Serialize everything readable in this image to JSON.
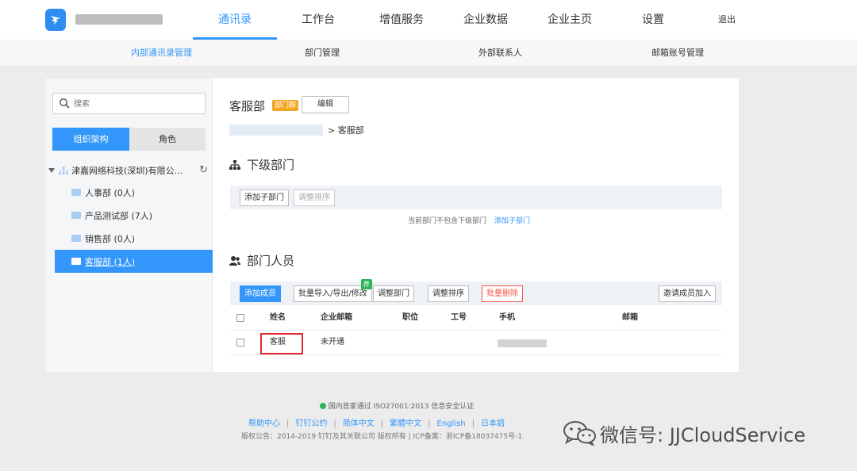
{
  "topbar": {
    "tabs": [
      {
        "label": "通讯录",
        "active": true
      },
      {
        "label": "工作台",
        "active": false
      },
      {
        "label": "增值服务",
        "active": false
      },
      {
        "label": "企业数据",
        "active": false
      },
      {
        "label": "企业主页",
        "active": false
      },
      {
        "label": "设置",
        "active": false
      }
    ],
    "logout_label": "退出"
  },
  "subnav": {
    "items": [
      {
        "label": "内部通讯录管理",
        "active": true
      },
      {
        "label": "部门管理",
        "active": false
      },
      {
        "label": "外部联系人",
        "active": false
      },
      {
        "label": "邮箱账号管理",
        "active": false
      }
    ]
  },
  "sidebar": {
    "search_placeholder": "搜索",
    "segments": {
      "org": "组织架构",
      "role": "角色"
    },
    "root_label": "津嘉网络科技(深圳)有限公...",
    "departments": [
      {
        "label": "人事部 (0人)",
        "active": false
      },
      {
        "label": "产品测试部 (7人)",
        "active": false
      },
      {
        "label": "销售部 (0人)",
        "active": false
      },
      {
        "label": "客服部 (1人)",
        "active": true
      }
    ]
  },
  "content": {
    "dept_name": "客服部",
    "dept_badge": "部门群",
    "edit_label": "编辑",
    "breadcrumb_current": "> 客服部",
    "sub_dept": {
      "title": "下级部门",
      "add_label": "添加子部门",
      "sort_label": "调整排序",
      "empty_text": "当前部门不包含下级部门",
      "empty_link": "添加子部门"
    },
    "members": {
      "title": "部门人员",
      "add_label": "添加成员",
      "batch_label": "批量导入/导出/修改",
      "recommend_badge": "荐",
      "move_label": "调整部门",
      "sort_label": "调整排序",
      "delete_label": "批量删除",
      "invite_label": "邀请成员加入",
      "columns": [
        "姓名",
        "企业邮箱",
        "职位",
        "工号",
        "手机",
        "邮箱"
      ],
      "rows": [
        {
          "name": "客服",
          "corp_email": "未开通",
          "position": "",
          "job_no": "",
          "email": ""
        }
      ]
    }
  },
  "footer": {
    "cert": "国内首家通过 ISO27001:2013 信息安全认证",
    "links": [
      "帮助中心",
      "钉钉公约",
      "简体中文",
      "繁體中文",
      "English",
      "日本語"
    ],
    "copyright": "版权公告：2014-2019 钉钉及其关联公司 版权所有 | ICP备案：浙ICP备18037475号-1"
  },
  "watermark": "微信号: JJCloudService",
  "colors": {
    "accent": "#3296fa",
    "danger": "#f25643",
    "highlight": "#e3272b",
    "badge": "#f5a623"
  }
}
